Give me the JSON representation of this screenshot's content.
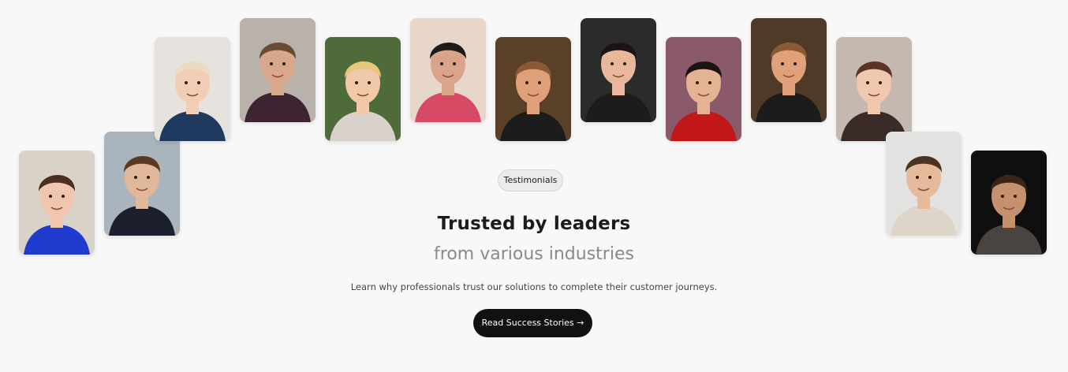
{
  "badge": {
    "label": "Testimonials"
  },
  "headline": {
    "title": "Trusted by leaders",
    "subtitle": "from various industries"
  },
  "description": "Learn why professionals trust our solutions to complete their customer journeys.",
  "cta": {
    "label": "Read Success Stories →"
  },
  "avatars": [
    {
      "name": "avatar-young-man-blue-shirt",
      "bg": "#d9d2c8",
      "skin": "#f0c6b0",
      "hair": "#4a2f20",
      "shirt": "#1f3ccf"
    },
    {
      "name": "avatar-man-dark-suit",
      "bg": "#a9b4bd",
      "skin": "#e2b89a",
      "hair": "#5b3a24",
      "shirt": "#1b1f2e"
    },
    {
      "name": "avatar-woman-blonde-bob",
      "bg": "#e6e3df",
      "skin": "#f1cdb6",
      "hair": "#e8dcc2",
      "shirt": "#1f3a5e"
    },
    {
      "name": "avatar-man-beard",
      "bg": "#b8b2aa",
      "skin": "#d9a78b",
      "hair": "#6a4a33",
      "shirt": "#3d2430"
    },
    {
      "name": "avatar-woman-blonde-long",
      "bg": "#4f6b3a",
      "skin": "#f2c9a8",
      "hair": "#e9c77a",
      "shirt": "#d9d2cc"
    },
    {
      "name": "avatar-man-glasses-pink-shirt",
      "bg": "#e7d7cb",
      "skin": "#d9a489",
      "hair": "#1d1a1a",
      "shirt": "#d64a64"
    },
    {
      "name": "avatar-man-lanyard",
      "bg": "#5b4028",
      "skin": "#e0a07a",
      "hair": "#8a5a36",
      "shirt": "#1c1c1c"
    },
    {
      "name": "avatar-woman-white-hat",
      "bg": "#2b2b2b",
      "skin": "#e9b89c",
      "hair": "#1a1412",
      "shirt": "#1c1c1c"
    },
    {
      "name": "avatar-woman-red-sign",
      "bg": "#8a5a6a",
      "skin": "#e3b394",
      "hair": "#1a1412",
      "shirt": "#c21818"
    },
    {
      "name": "avatar-man-lanyard-2",
      "bg": "#4e3a26",
      "skin": "#e0a07a",
      "hair": "#8a5a36",
      "shirt": "#1c1c1c"
    },
    {
      "name": "avatar-woman-brown-hair",
      "bg": "#c4b8b0",
      "skin": "#f0c8b0",
      "hair": "#5a3424",
      "shirt": "#3a2a28"
    },
    {
      "name": "avatar-man-glasses-jacket",
      "bg": "#e2e2e0",
      "skin": "#e5bb9c",
      "hair": "#4a3424",
      "shirt": "#ddd6c8"
    },
    {
      "name": "avatar-man-dark-sweater",
      "bg": "#0f0f0f",
      "skin": "#c4906e",
      "hair": "#3a2618",
      "shirt": "#4a4440"
    }
  ]
}
